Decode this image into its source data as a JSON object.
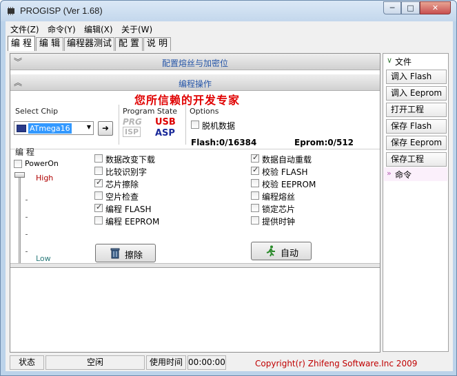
{
  "window": {
    "title": "PROGISP (Ver 1.68)",
    "min": "─",
    "max": "□",
    "close": "✕"
  },
  "menu": [
    {
      "label": "文件(Z)"
    },
    {
      "label": "命令(Y)"
    },
    {
      "label": "编辑(X)"
    },
    {
      "label": "关于(W)"
    }
  ],
  "tabs": [
    {
      "label": "编 程",
      "active": true
    },
    {
      "label": "编 辑"
    },
    {
      "label": "编程器测试"
    },
    {
      "label": "配 置"
    },
    {
      "label": "说 明"
    }
  ],
  "bands": {
    "fuse": "配置熔丝与加密位",
    "ops": "编程操作"
  },
  "slogan": "您所信赖的开发专家",
  "select_chip": {
    "title": "Select Chip",
    "value": "ATmega16"
  },
  "program_state": {
    "title": "Program State",
    "prg": "PRG",
    "isp": "ISP",
    "usb": "USB",
    "asp": "ASP"
  },
  "options": {
    "title": "Options",
    "offline": {
      "label": "脱机数据",
      "checked": false
    },
    "flash": "Flash:0/16384",
    "eprom": "Eprom:0/512"
  },
  "program": {
    "title": "编 程",
    "poweron": {
      "label": "PowerOn",
      "checked": false
    },
    "high": "High",
    "low": "Low",
    "level": 1.0,
    "col1": [
      {
        "label": "数据改变下载",
        "checked": false
      },
      {
        "label": "比较识别字",
        "checked": false
      },
      {
        "label": "芯片擦除",
        "checked": true
      },
      {
        "label": "空片检查",
        "checked": false
      },
      {
        "label": "编程 FLASH",
        "checked": true
      },
      {
        "label": "编程 EEPROM",
        "checked": false
      }
    ],
    "col2": [
      {
        "label": "数据自动重载",
        "checked": true
      },
      {
        "label": "校验 FLASH",
        "checked": true
      },
      {
        "label": "校验 EEPROM",
        "checked": false
      },
      {
        "label": "编程熔丝",
        "checked": false
      },
      {
        "label": "锁定芯片",
        "checked": false
      },
      {
        "label": "提供时钟",
        "checked": false
      }
    ],
    "erase_button": "擦除",
    "auto_button": "自动"
  },
  "sidebar": {
    "file_header": "文件",
    "items": [
      {
        "label": "调入 Flash"
      },
      {
        "label": "调入 Eeprom"
      },
      {
        "label": "打开工程"
      },
      {
        "label": "保存 Flash"
      },
      {
        "label": "保存 Eeprom"
      },
      {
        "label": "保存工程"
      }
    ],
    "command_header": "命令",
    "chev_open": "∨",
    "chev_closed": "»"
  },
  "status": {
    "state_label": "状态",
    "state_value": "空闲",
    "time_label": "使用时间",
    "time_value": "00:00:00",
    "copyright": "Copyright(r) Zhifeng Software.Inc 2009"
  },
  "colors": {
    "slogan": "#e00000",
    "band_text": "#2656a8",
    "copyright": "#c00000",
    "high_label": "#b00000",
    "low_label": "#2a7a7a"
  }
}
